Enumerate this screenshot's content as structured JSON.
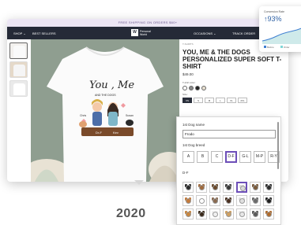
{
  "promo_bar": {
    "text": "FREE SHIPPING ON ORDERS $60+"
  },
  "nav": {
    "shop": "SHOP ⌄",
    "best_sellers": "BEST SELLERS",
    "logo_mark": "W",
    "logo_text_line1": "Personal",
    "logo_text_line2": "World",
    "occasions": "OCCASIONS ⌄",
    "track_order": "TRACK ORDER"
  },
  "product": {
    "breadcrumb": "T-SHIRTS",
    "title": "YOU, ME & THE DOGS PERSONALIZED SUPER SOFT T-SHIRT",
    "price": "$49.00",
    "color_label": "T-shirt color:",
    "colors": [
      "#ffffff",
      "#8a8a8a",
      "#222222",
      "#e8e0d0"
    ],
    "size_label": "Size:",
    "size_guide": "Size Guide",
    "sizes": [
      "XS",
      "S",
      "M",
      "L",
      "XL",
      "2XL"
    ],
    "selected_size": "XS",
    "shirt_text": {
      "line1": "You , Me",
      "line2": "AND THE DOGS",
      "name1": "Chris",
      "name2": "Susan",
      "badge1": "Dr-F",
      "badge2": "Kev"
    }
  },
  "personalize": {
    "dog_name_label": "1st Dog name",
    "dog_name_value": "Frodo",
    "dog_breed_label": "1st Dog breed",
    "breed_groups": [
      "A",
      "B",
      "C",
      "D-F",
      "G-L",
      "M-P",
      "R-Y"
    ],
    "selected_group": "D-F",
    "group_label": "D-F",
    "dog_colors": [
      "#2b2b2b",
      "#a06a3c",
      "#6b4a2b",
      "#3a3a3a",
      "#d9d9d9",
      "#7a5a3a",
      "#2e2e2e",
      "#c47a3a",
      "#ffffff",
      "#8a6a50",
      "#4a3020",
      "#e0e0e0",
      "#6a6a6a",
      "#1f1f1f",
      "#c9863e",
      "#3a2a1a",
      "#f0f0f0",
      "#d0a060",
      "#e8e8e8",
      "#5a5a5a",
      "#b06a2a"
    ],
    "selected_dog_index": 4
  },
  "conversion": {
    "label": "Conversion Rate",
    "value": "↑93%",
    "legend": [
      "Before",
      "Order"
    ],
    "legend_colors": [
      "#3f7fd1",
      "#7fd6d6"
    ]
  },
  "timeline": {
    "year": "2020"
  }
}
